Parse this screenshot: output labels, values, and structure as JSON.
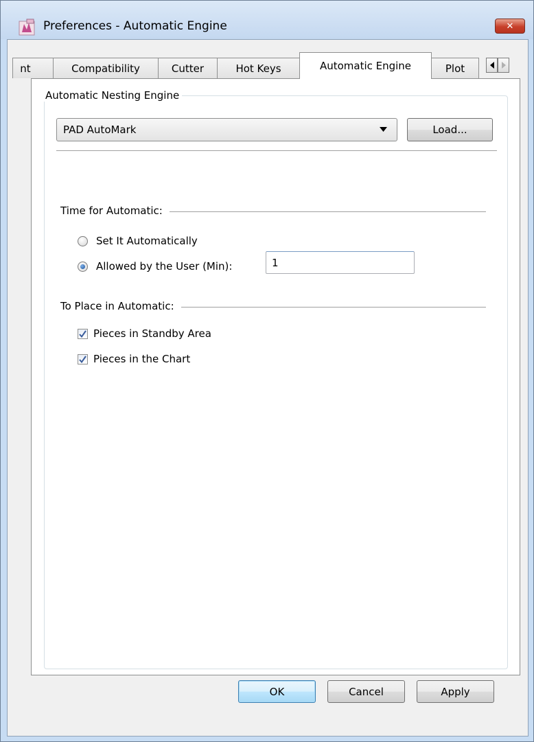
{
  "window": {
    "title": "Preferences - Automatic Engine",
    "close_symbol": "✕"
  },
  "tabs": [
    {
      "label": "nt"
    },
    {
      "label": "Compatibility"
    },
    {
      "label": "Cutter"
    },
    {
      "label": "Hot Keys"
    },
    {
      "label": "Automatic Engine",
      "active": true
    },
    {
      "label": "Plot"
    }
  ],
  "engine_group": {
    "legend": "Automatic Nesting Engine",
    "selected_engine": "PAD AutoMark",
    "load_label": "Load..."
  },
  "time_section": {
    "label": "Time for Automatic:",
    "options": [
      {
        "label": "Set It Automatically",
        "selected": false
      },
      {
        "label": "Allowed by the User (Min):",
        "selected": true
      }
    ],
    "minutes_value": "1"
  },
  "place_section": {
    "label": "To Place in Automatic:",
    "options": [
      {
        "label": "Pieces in Standby Area",
        "checked": true
      },
      {
        "label": "Pieces in the Chart",
        "checked": true
      }
    ]
  },
  "buttons": {
    "ok": "OK",
    "cancel": "Cancel",
    "apply": "Apply"
  },
  "colors": {
    "title_bar": "#c7dcf3",
    "close_button": "#c7402a",
    "dialog_background": "#f0f0f0",
    "default_button": "#bee6fd"
  }
}
